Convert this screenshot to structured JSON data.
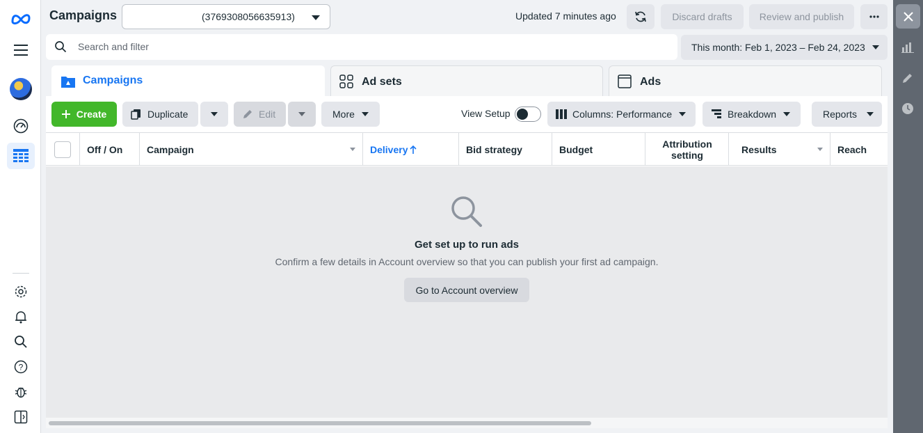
{
  "app": {
    "title": "Campaigns",
    "account_value": "(3769308056635913)",
    "updated_text": "Updated 7 minutes ago"
  },
  "topbar": {
    "discard_label": "Discard drafts",
    "review_label": "Review and publish",
    "more_icon": "ellipsis-icon",
    "refresh_icon": "refresh-icon"
  },
  "search": {
    "placeholder": "Search and filter"
  },
  "date_range": {
    "label": "This month: Feb 1, 2023 – Feb 24, 2023"
  },
  "tabs": [
    {
      "label": "Campaigns",
      "icon": "folder-icon",
      "active": true
    },
    {
      "label": "Ad sets",
      "icon": "grid-icon",
      "active": false
    },
    {
      "label": "Ads",
      "icon": "ad-frame-icon",
      "active": false
    }
  ],
  "toolbar": {
    "create_label": "Create",
    "duplicate_label": "Duplicate",
    "edit_label": "Edit",
    "more_label": "More",
    "view_setup_label": "View Setup",
    "columns_label": "Columns: Performance",
    "breakdown_label": "Breakdown",
    "reports_label": "Reports"
  },
  "table": {
    "columns": [
      "Off / On",
      "Campaign",
      "Delivery",
      "Bid strategy",
      "Budget",
      "Attribution setting",
      "Results",
      "Reach"
    ],
    "sorted_column": "Delivery",
    "sort_direction": "ascending"
  },
  "empty_state": {
    "title": "Get set up to run ads",
    "subtitle": "Confirm a few details in Account overview so that you can publish your first ad campaign.",
    "button_label": "Go to Account overview"
  },
  "colors": {
    "accent": "#1876f2",
    "create": "#42b72a",
    "rail": "#606770"
  }
}
